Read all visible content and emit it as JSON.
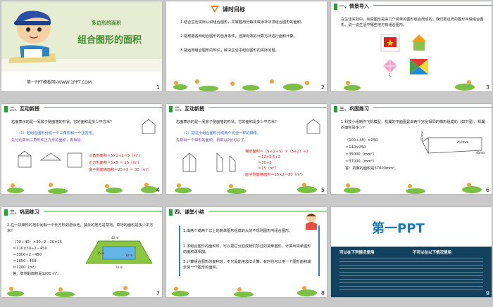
{
  "slides": [
    {
      "number": "1",
      "subtitle": "多边形的面积",
      "title": "组合图形的面积",
      "footer": "第一PPT模板网-WWW.1PPT.COM"
    },
    {
      "number": "2",
      "heading": "课时目标",
      "goals": [
        "1.结合生活实际认识组合图形，并掌握用分解法或添补法求组合图形的面积。",
        "2.能根据各种组合图形的自身条件，选择有效的计算方法进行面积计算。",
        "3.能运用组合图形的知识，解决生活中组合图形的实际问题。"
      ]
    },
    {
      "number": "3",
      "section": "一、情景导入",
      "body": "在生活实际中，有些图形是由几个简单的图形组合而成的，我们把这样的图形叫做组合图形。说一说生活中哪些地方有组合图形。"
    },
    {
      "number": "4",
      "section": "二、互动新授",
      "question": "右面表示的是一间房子侧面墙的形状。它的面积是多少平方米？",
      "method": "（1）把组合图形分成一个三角形和一个正方形。",
      "method2": "先分别算出三角形和正方形的面积，再相加。",
      "calc": [
        "三角形面积＝5×2÷2＝5（m²）",
        "正方形面积＝5×5 ＝ 25（m²）",
        "房子侧面墙面积＝25＋5 ＝ 30（m²）"
      ]
    },
    {
      "number": "5",
      "section": "二、互动新授",
      "question": "右面表示的是一间房子侧面墙的形状。它的面积是多少平方米？",
      "method": "（2）把这个组合图形分成两个完全一样的梯形。",
      "method2": "先算出一个梯形的面积，再乘以2就可以了。",
      "calc": [
        "梯形面积＝（5＋2＋5）×（5÷2）÷2",
        "＝12×2.5÷2",
        "＝30÷2",
        "＝15（m²）",
        "房子侧面墙面积＝15×2＝30（m²）"
      ]
    },
    {
      "number": "6",
      "section": "三、巩固练习",
      "question": "1.科技小组制作飞机模型，机翼的平面图是由两个完全相同的梯形组成的（如下图）。机翼的面积是多少？",
      "calc": [
        "（100＋40）×250",
        "＝140×250",
        "＝35000（mm²）",
        "＝37000（mm²）",
        "答：机翼的面积是37000mm²。"
      ],
      "labels": [
        "100mm",
        "250mm",
        "40mm"
      ]
    },
    {
      "number": "7",
      "section": "三、巩固练习",
      "question": "2.在一块梯形的地中间有一个长方形的游泳池，其余的地方是草地。草地的面积是多少平方米？",
      "calc": [
        "（70＋40）×30÷2－30×15",
        "＝110×30÷2－450",
        "＝3300÷2－450",
        "＝1650－450",
        "＝1200（m²）",
        "答：草地的面积是1200 m²。"
      ],
      "labels": [
        "40 m",
        "30 m",
        "15 m",
        "70 m"
      ]
    },
    {
      "number": "8",
      "section": "四、课堂小结",
      "points": [
        "1.由两个或两个以上的简单图形组成的大的不规则图形叫组合图形。",
        "2.求组合图形的面积时，可以把它分割成我们学过的简单图形，计算出简单图形的面积再相加。",
        "3.计算组合图形的面积时，不只是能用加法计算，有时也可以用一个图形面积减去另一个图形的面积。"
      ]
    },
    {
      "number": "9",
      "brand": "第一PPT",
      "can_title": "可以在下列情况使用",
      "cannot_title": "不可以在以下情况使用"
    }
  ]
}
